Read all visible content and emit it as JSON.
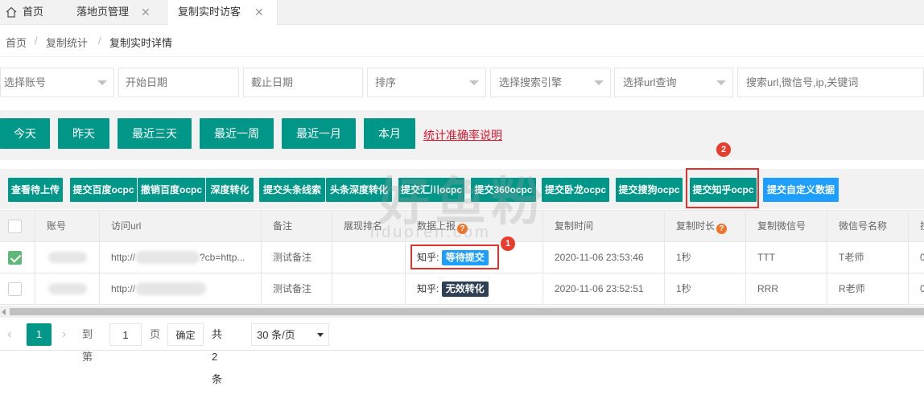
{
  "tabs": [
    {
      "label": "首页"
    },
    {
      "label": "落地页管理"
    },
    {
      "label": "复制实时访客"
    }
  ],
  "breadcrumb": {
    "home": "首页",
    "parent": "复制统计",
    "current": "复制实时详情",
    "sep": "/"
  },
  "filters": {
    "account": "选择账号",
    "start_date": "开始日期",
    "end_date": "截止日期",
    "sort": "排序",
    "engine": "选择搜索引擎",
    "url": "选择url查询",
    "search": "搜索url,微信号,ip,关键词"
  },
  "quick_dates": [
    "今天",
    "昨天",
    "最近三天",
    "最近一周",
    "最近一月",
    "本月"
  ],
  "accuracy_link": "统计准确率说明",
  "actions": [
    "查看待上传",
    "提交百度ocpc",
    "撤销百度ocpc",
    "深度转化",
    "提交头条线索",
    "头条深度转化",
    "提交汇川ocpc",
    "提交360ocpc",
    "提交卧龙ocpc",
    "提交搜狗ocpc",
    "提交知乎ocpc",
    "提交自定义数据"
  ],
  "annotations": {
    "one": "1",
    "two": "2"
  },
  "table": {
    "headers": [
      "账号",
      "访问url",
      "备注",
      "展现排名",
      "数据上报",
      "复制时间",
      "复制时长",
      "复制微信号",
      "微信号名称",
      "搜"
    ],
    "qmark": "?",
    "rows": [
      {
        "url": "http://",
        "url_tail": "?cb=http...",
        "note": "测试备注",
        "platform": "知乎:",
        "status": "等待提交",
        "time": "2020-11-06 23:53:46",
        "duration": "1秒",
        "wechat": "TTT",
        "wechat_name": "T老师",
        "last": "0"
      },
      {
        "url": "http://",
        "url_tail": "",
        "note": "测试备注",
        "platform": "知乎:",
        "status": "无效转化",
        "time": "2020-11-06 23:52:51",
        "duration": "1秒",
        "wechat": "RRR",
        "wechat_name": "R老师",
        "last": "0"
      }
    ]
  },
  "pagination": {
    "current": "1",
    "goto": "到第",
    "page_value": "1",
    "page": "页",
    "confirm": "确定",
    "total": "共 2 条",
    "per_page": "30 条/页"
  },
  "watermark": {
    "cn": "好鱼粉",
    "en": "nduoren.com"
  },
  "colors": {
    "primary": "#009688",
    "blue": "#1e9fff",
    "red": "#e0332e",
    "dark_tag": "#2f4056"
  }
}
